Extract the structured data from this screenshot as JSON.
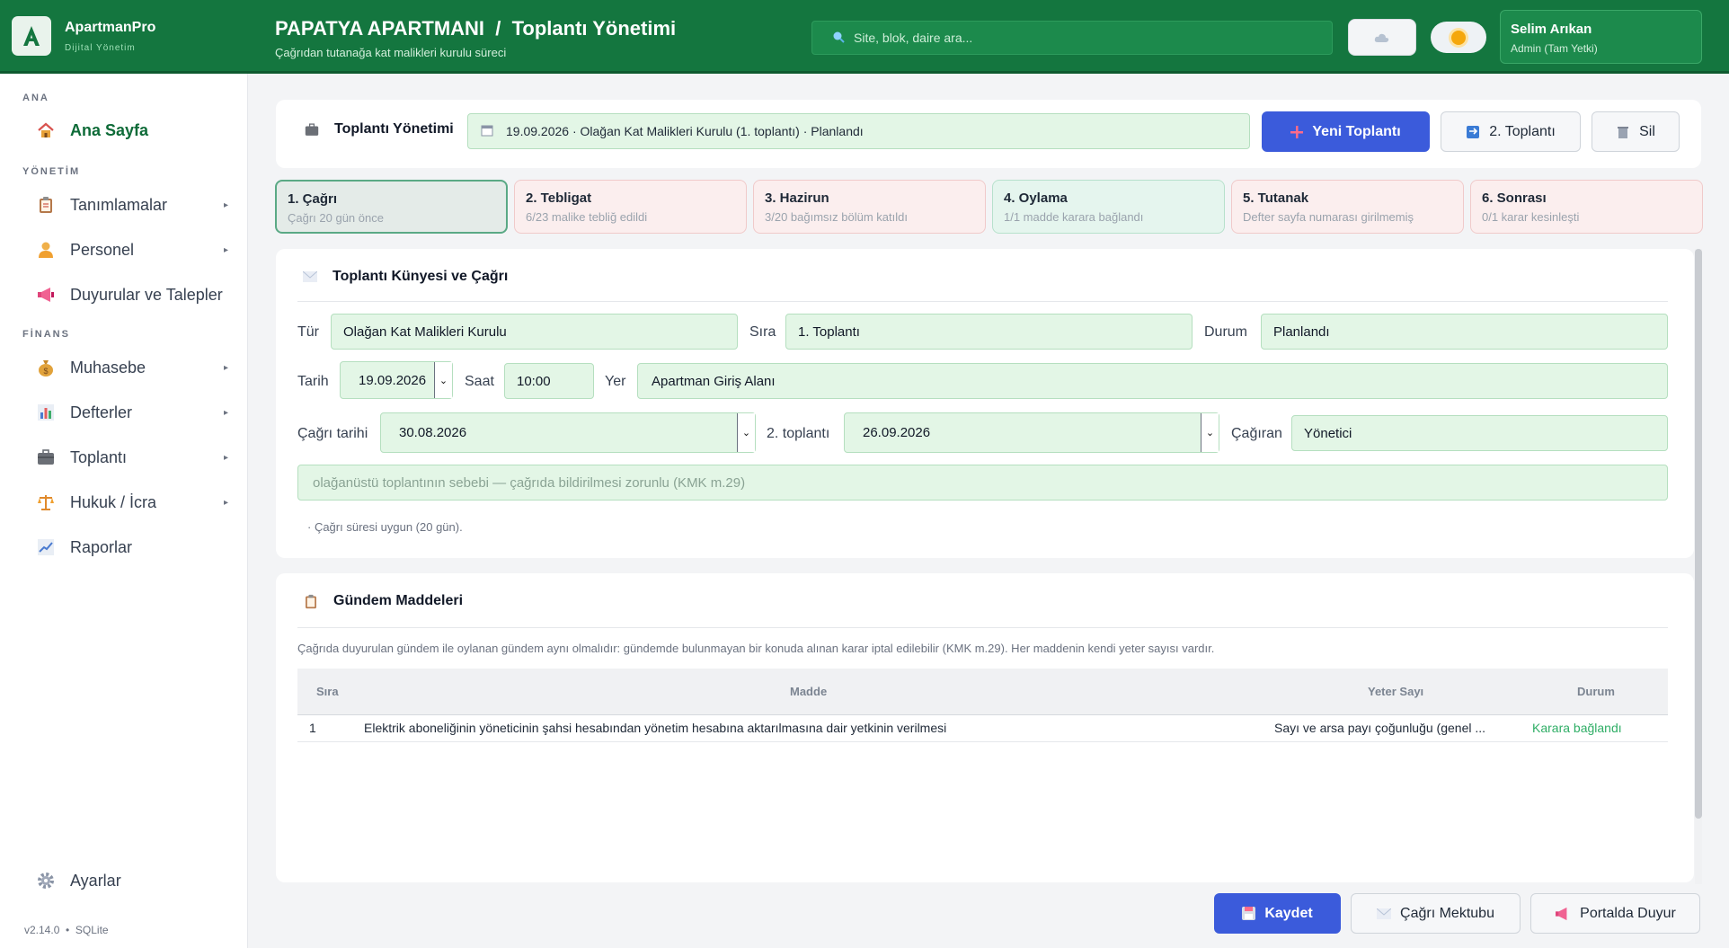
{
  "header": {
    "brand_name": "ApartmanPro",
    "brand_sub": "Dijital Yönetim",
    "title": "PAPATYA APARTMANI  /  Toplantı Yönetimi",
    "subtitle": "Çağrıdan tutanağa kat malikleri kurulu süreci",
    "search_placeholder": "Site, blok, daire ara...",
    "user_name": "Selim Arıkan",
    "user_role": "Admin (Tam Yetki)",
    "brand_color": "#14763f"
  },
  "sidebar": {
    "sections": {
      "ana": "ANA",
      "yonetim": "YÖNETİM",
      "finans": "FİNANS"
    },
    "items": [
      {
        "label": "Ana Sayfa",
        "icon": "home-icon"
      },
      {
        "label": "Tanımlamalar",
        "icon": "clipboard-icon"
      },
      {
        "label": "Personel",
        "icon": "person-icon"
      },
      {
        "label": "Duyurular ve Talepler",
        "icon": "megaphone-icon"
      },
      {
        "label": "Muhasebe",
        "icon": "money-bag-icon"
      },
      {
        "label": "Defterler",
        "icon": "bar-chart-icon"
      },
      {
        "label": "Toplantı",
        "icon": "briefcase-icon"
      },
      {
        "label": "Hukuk / İcra",
        "icon": "scales-icon"
      },
      {
        "label": "Raporlar",
        "icon": "line-chart-icon"
      },
      {
        "label": "Ayarlar",
        "icon": "gear-icon"
      }
    ],
    "version": "v2.14.0  •  SQLite"
  },
  "meeting_bar": {
    "title": "Toplantı Yönetimi",
    "selected": "19.09.2026 · Olağan Kat Malikleri Kurulu (1. toplantı) · Planlandı",
    "new_button": "Yeni Toplantı",
    "second_button": "2. Toplantı",
    "delete_button": "Sil"
  },
  "steps": [
    {
      "title": "1. Çağrı",
      "sub": "Çağrı 20 gün önce",
      "state": "active"
    },
    {
      "title": "2. Tebligat",
      "sub": "6/23 malike tebliğ edildi",
      "state": "pink"
    },
    {
      "title": "3. Hazirun",
      "sub": "3/20 bağımsız bölüm katıldı",
      "state": "pink"
    },
    {
      "title": "4. Oylama",
      "sub": "1/1 madde karara bağlandı",
      "state": "green"
    },
    {
      "title": "5. Tutanak",
      "sub": "Defter sayfa numarası girilmemiş",
      "state": "pink"
    },
    {
      "title": "6. Sonrası",
      "sub": "0/1 karar kesinleşti",
      "state": "pink"
    }
  ],
  "kunye": {
    "title": "Toplantı Künyesi ve Çağrı",
    "labels": {
      "tur": "Tür",
      "sira": "Sıra",
      "durum": "Durum",
      "tarih": "Tarih",
      "saat": "Saat",
      "yer": "Yer",
      "cagri_tarihi": "Çağrı tarihi",
      "ikinci": "2. toplantı",
      "cagiran": "Çağıran"
    },
    "values": {
      "tur": "Olağan Kat Malikleri Kurulu",
      "sira": "1. Toplantı",
      "durum": "Planlandı",
      "tarih": "19.09.2026",
      "saat": "10:00",
      "yer": "Apartman Giriş Alanı",
      "cagri_tarihi": "30.08.2026",
      "ikinci": "26.09.2026",
      "cagiran": "Yönetici"
    },
    "reason_placeholder": "olağanüstü toplantının sebebi — çağrıda bildirilmesi zorunlu (KMK m.29)",
    "note": "· Çağrı süresi uygun (20 gün)."
  },
  "gundem": {
    "title": "Gündem Maddeleri",
    "note": "Çağrıda duyurulan gündem ile oylanan gündem aynı olmalıdır: gündemde bulunmayan bir konuda alınan karar iptal edilebilir (KMK m.29). Her maddenin kendi yeter sayısı vardır.",
    "columns": [
      "Sıra",
      "Madde",
      "Yeter Sayı",
      "Durum"
    ],
    "rows": [
      {
        "sira": "1",
        "madde": "Elektrik aboneliğinin yöneticinin şahsi hesabından yönetim hesabına aktarılmasına dair yetkinin verilmesi",
        "yeter": "Sayı ve arsa payı çoğunluğu (genel ...",
        "durum": "Karara bağlandı"
      }
    ]
  },
  "footer_buttons": {
    "save": "Kaydet",
    "letter": "Çağrı Mektubu",
    "portal": "Portalda Duyur"
  }
}
